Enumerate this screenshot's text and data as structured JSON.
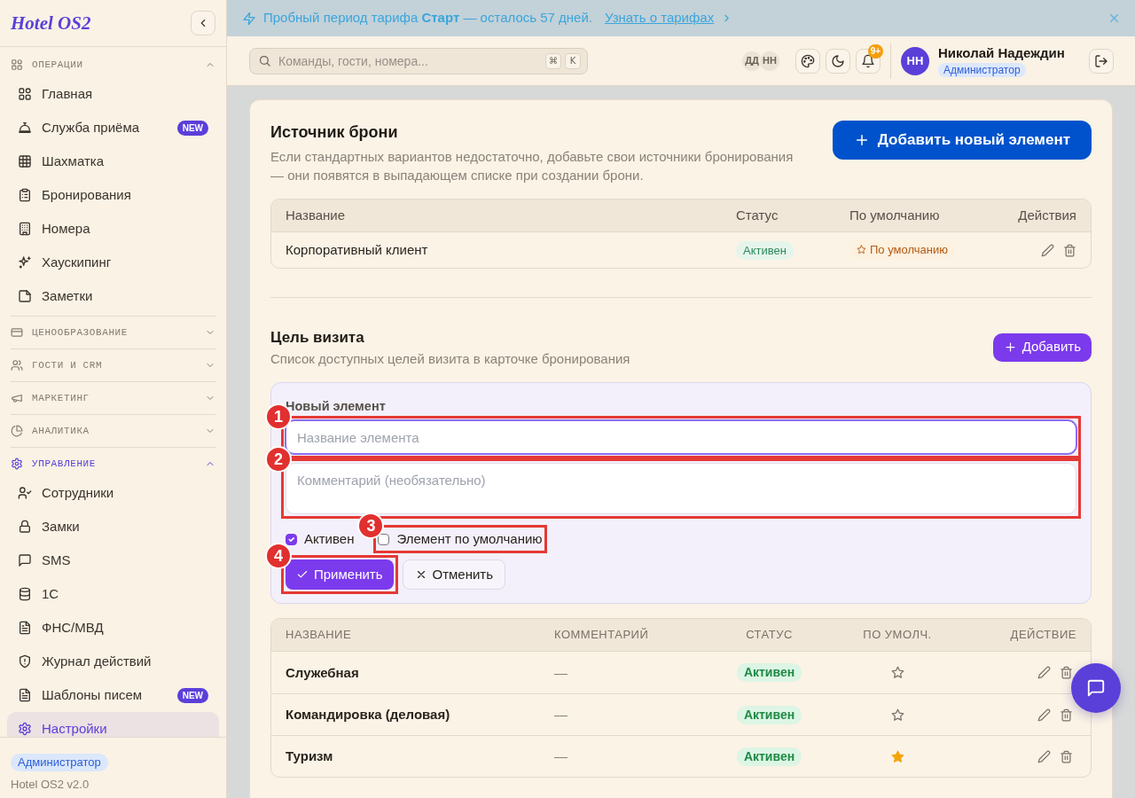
{
  "sidebar": {
    "logo": "Hotel OS2",
    "groups": [
      {
        "title": "ОПЕРАЦИИ",
        "expanded": true,
        "items": [
          {
            "label": "Главная",
            "selected": false
          },
          {
            "label": "Служба приёма",
            "selected": false,
            "badge": "NEW"
          },
          {
            "label": "Шахматка",
            "selected": false
          },
          {
            "label": "Бронирования",
            "selected": false
          },
          {
            "label": "Номера",
            "selected": false
          },
          {
            "label": "Хаускипинг",
            "selected": false
          },
          {
            "label": "Заметки",
            "selected": false
          }
        ]
      },
      {
        "title": "ЦЕНООБРАЗОВАНИЕ",
        "expanded": false
      },
      {
        "title": "ГОСТИ И CRM",
        "expanded": false
      },
      {
        "title": "МАРКЕТИНГ",
        "expanded": false
      },
      {
        "title": "АНАЛИТИКА",
        "expanded": false
      },
      {
        "title": "УПРАВЛЕНИЕ",
        "expanded": true,
        "items": [
          {
            "label": "Сотрудники",
            "selected": false
          },
          {
            "label": "Замки",
            "selected": false
          },
          {
            "label": "SMS",
            "selected": false
          },
          {
            "label": "1С",
            "selected": false
          },
          {
            "label": "ФНС/МВД",
            "selected": false
          },
          {
            "label": "Журнал действий",
            "selected": false
          },
          {
            "label": "Шаблоны писем",
            "selected": false,
            "badge": "NEW"
          },
          {
            "label": "Настройки",
            "selected": true
          }
        ]
      }
    ],
    "role_badge": "Администратор",
    "version": "Hotel OS2 v2.0"
  },
  "banner": {
    "text": "Пробный период тарифа **Старт** — осталось 57 дней.",
    "link": "Узнать о тарифах"
  },
  "topbar": {
    "search": {
      "placeholder": "Команды, гости, номера...",
      "keys": [
        "⌘",
        "K"
      ]
    },
    "presence": [
      "ДД",
      "НН"
    ],
    "notifications": "9+",
    "user": {
      "initials": "НН",
      "name": "Николай Надеждин",
      "role": "Администратор"
    }
  },
  "booking_sources": {
    "title": "Источник брони",
    "description": "Если стандартных вариантов недостаточно, добавьте свои источники бронирования — они появятся в выпадающем списке при создании брони.",
    "add_button": "Добавить новый элемент",
    "columns": [
      "Название",
      "Статус",
      "По умолчанию",
      "Действия"
    ],
    "rows": [
      {
        "name": "Корпоративный клиент",
        "status": "Активен",
        "default": true,
        "default_label": "По умолчанию"
      }
    ]
  },
  "visit_purposes": {
    "title": "Цель визита",
    "description": "Список доступных целей визита в карточке бронирования",
    "add_button": "Добавить",
    "form": {
      "title": "Новый элемент",
      "name_field": {
        "placeholder": "Название элемента",
        "focused": true,
        "callout": "1"
      },
      "comment_field": {
        "placeholder": "Комментарий (необязательно)",
        "callout": "2"
      },
      "checkboxes": [
        {
          "label": "Активен",
          "checked": true
        },
        {
          "label": "Элемент по умолчанию",
          "checked": false,
          "callout": "3"
        }
      ],
      "buttons": [
        {
          "kind": "apply",
          "label": "Применить",
          "callout": "4"
        },
        {
          "kind": "cancel",
          "label": "Отменить"
        }
      ]
    },
    "columns": [
      "НАЗВАНИЕ",
      "КОММЕНТАРИЙ",
      "СТАТУС",
      "ПО УМОЛЧ.",
      "ДЕЙСТВИЕ"
    ],
    "rows": [
      {
        "name": "Служебная",
        "comment": "—",
        "status": "Активен",
        "default": false
      },
      {
        "name": "Командировка (деловая)",
        "comment": "—",
        "status": "Активен",
        "default": false
      },
      {
        "name": "Туризм",
        "comment": "—",
        "status": "Активен",
        "default": true
      }
    ]
  }
}
